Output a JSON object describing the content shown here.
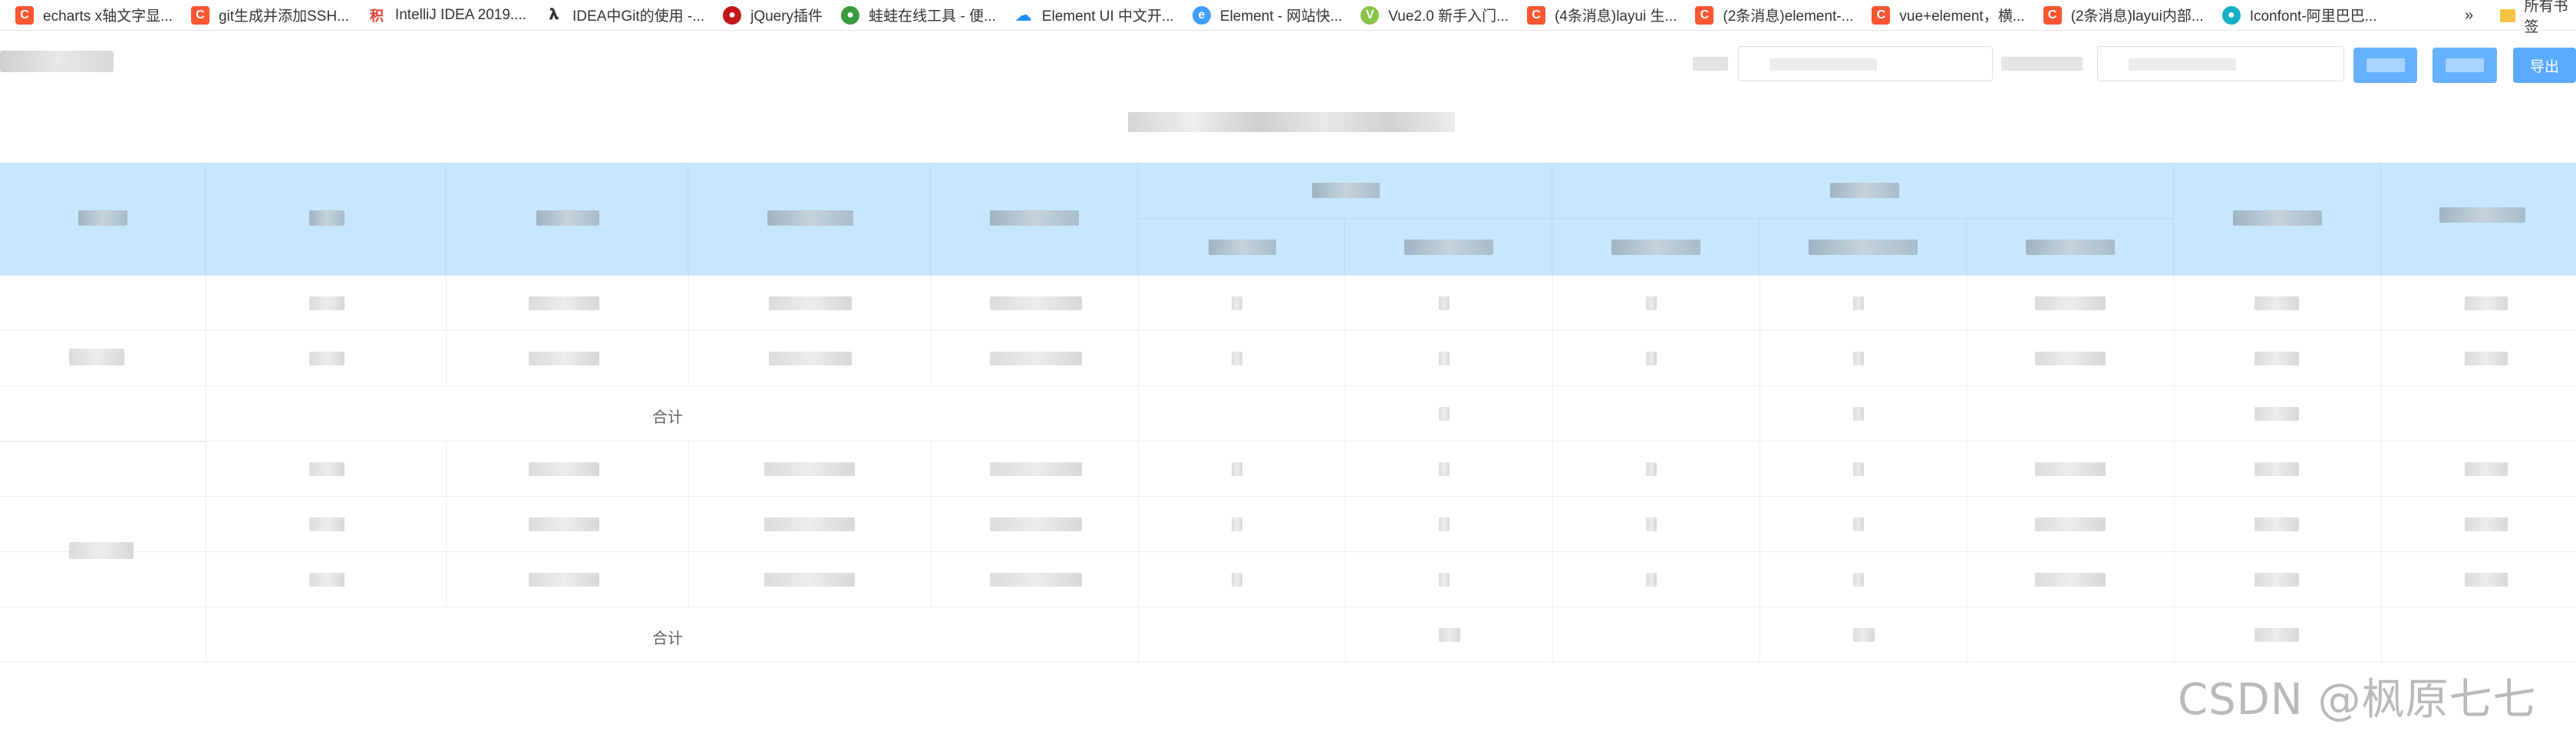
{
  "bookmarks": [
    {
      "icon": "csdn-icon",
      "label": "echarts x轴文字显..."
    },
    {
      "icon": "csdn-icon",
      "label": "git生成并添加SSH..."
    },
    {
      "icon": "jihuo-icon",
      "label": "IntelliJ IDEA 2019...."
    },
    {
      "icon": "idea-icon",
      "label": "IDEA中Git的使用 -..."
    },
    {
      "icon": "jquery-icon",
      "label": "jQuery插件"
    },
    {
      "icon": "frog-icon",
      "label": "蛙蛙在线工具 - 便..."
    },
    {
      "icon": "cloud-icon",
      "label": "Element UI 中文开..."
    },
    {
      "icon": "element-icon",
      "label": "Element - 网站快..."
    },
    {
      "icon": "vue-icon",
      "label": "Vue2.0 新手入门..."
    },
    {
      "icon": "csdn-icon",
      "label": "(4条消息)layui 生..."
    },
    {
      "icon": "csdn-icon",
      "label": "(2条消息)element-..."
    },
    {
      "icon": "csdn-icon",
      "label": "vue+element，横..."
    },
    {
      "icon": "csdn-icon",
      "label": "(2条消息)layui内部..."
    },
    {
      "icon": "iconfont-icon",
      "label": "Iconfont-阿里巴巴..."
    }
  ],
  "bookmarks_more": "»",
  "bookmarks_folder": "所有书签",
  "toolbar": {
    "export_label": "导出"
  },
  "table": {
    "total_label": "合计"
  },
  "watermark": "CSDN @枫原七七"
}
